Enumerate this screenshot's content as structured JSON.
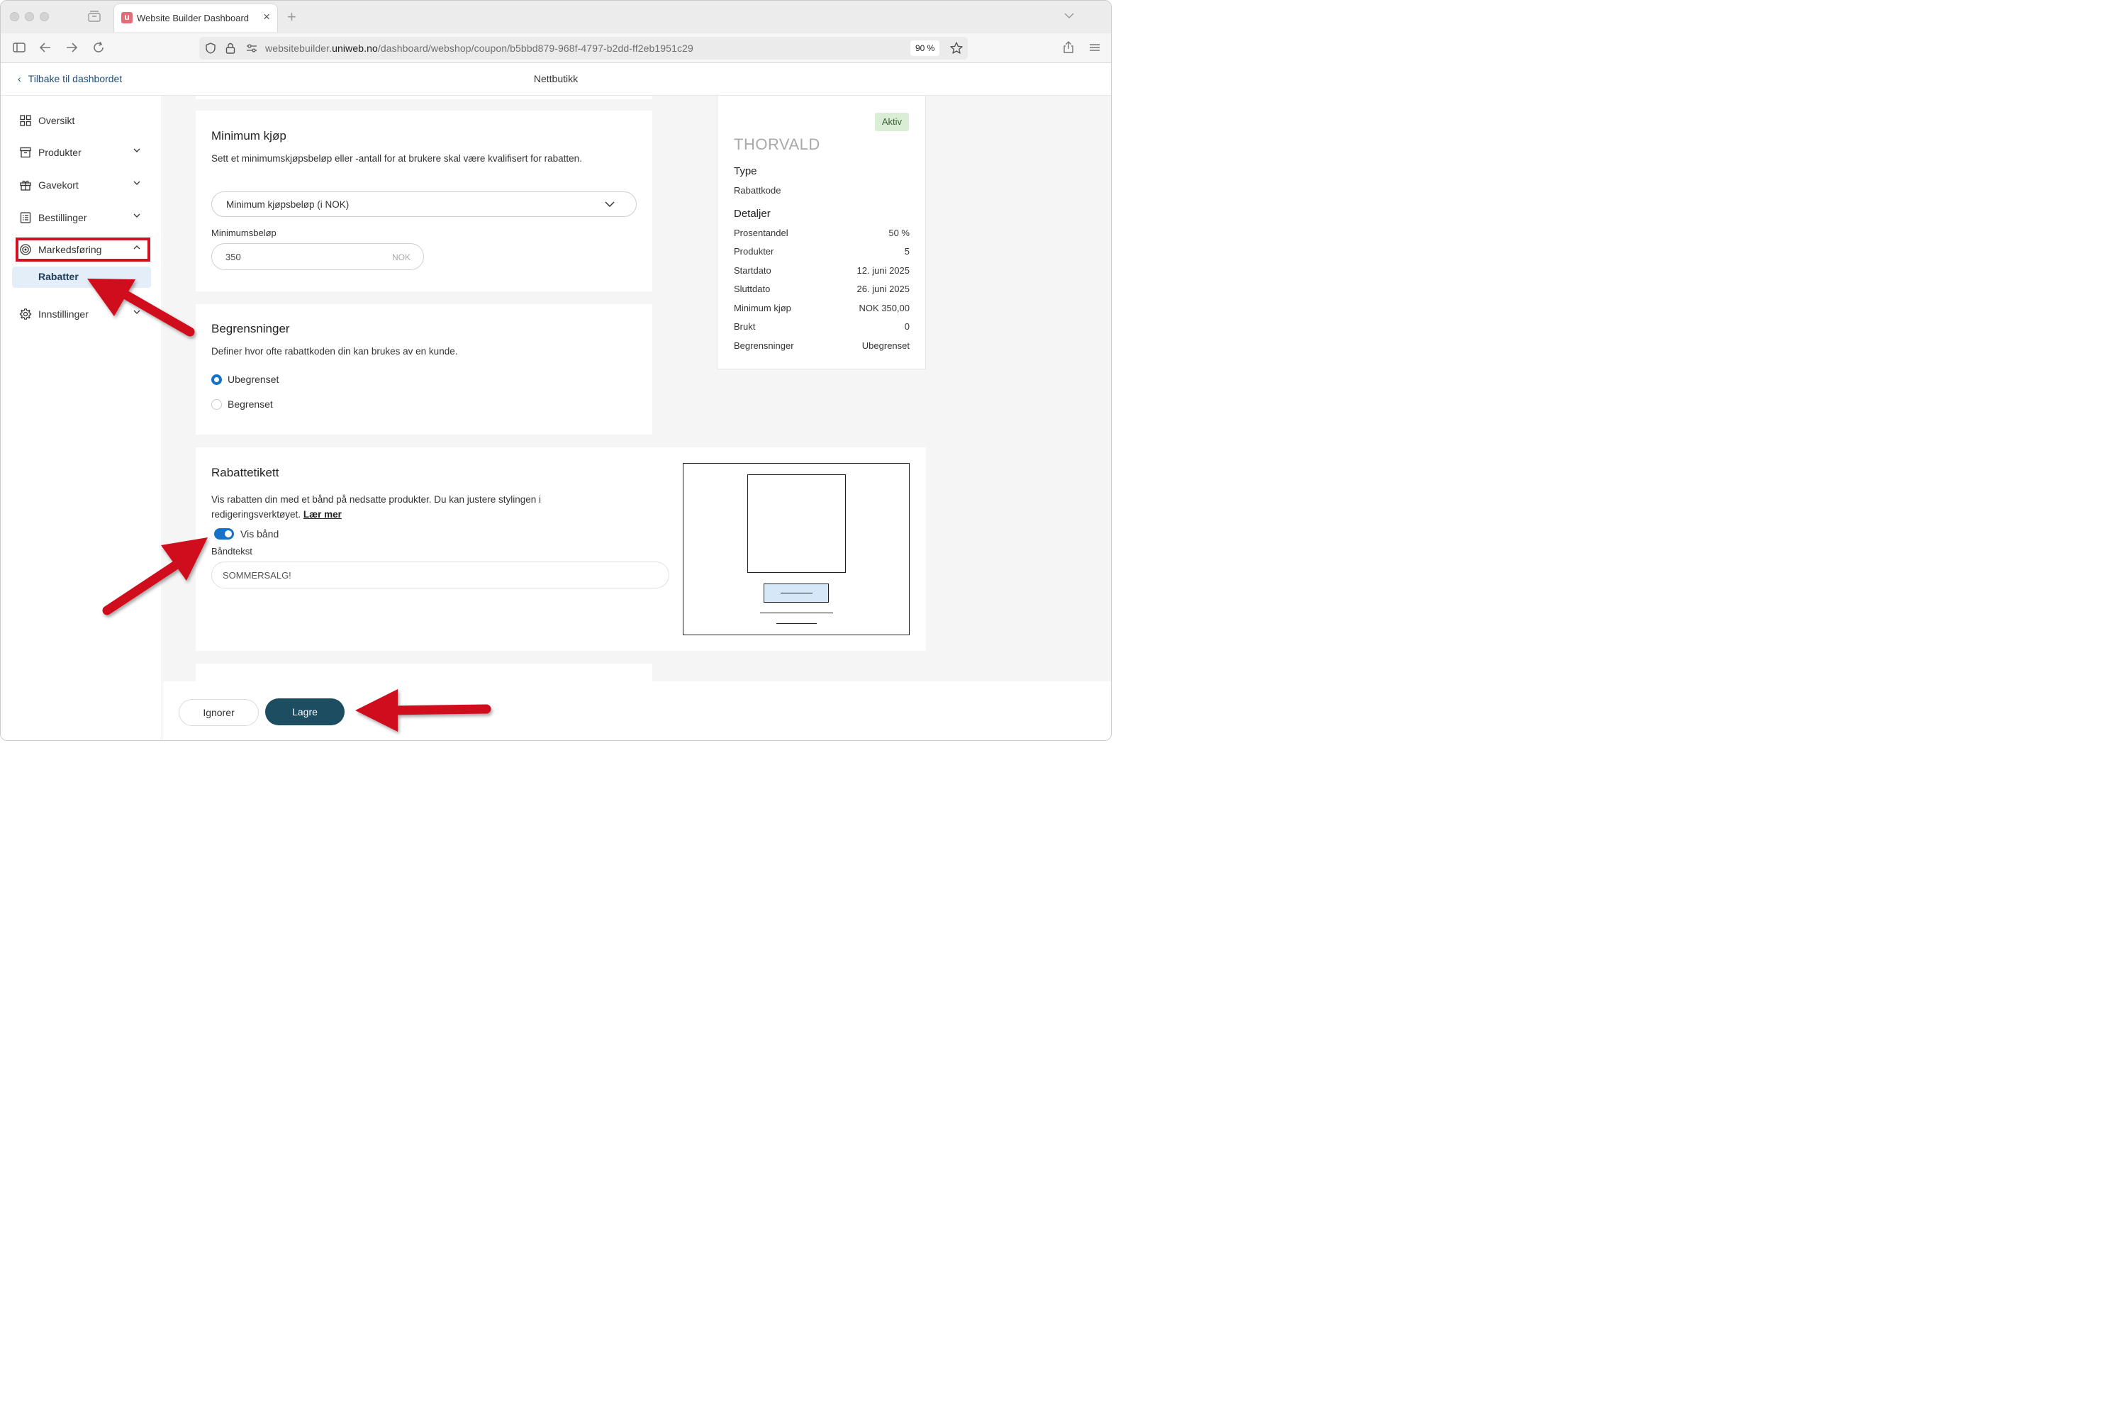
{
  "browser": {
    "tab_title": "Website Builder Dashboard",
    "favicon_letter": "u",
    "url_prefix": "websitebuilder.",
    "url_domain": "uniweb.no",
    "url_path": "/dashboard/webshop/coupon/b5bbd879-968f-4797-b2dd-ff2eb1951c29",
    "zoom": "90 %"
  },
  "header": {
    "back_label": "Tilbake til dashbordet",
    "title": "Nettbutikk"
  },
  "sidebar": {
    "items": [
      {
        "label": "Oversikt",
        "icon": "grid-icon"
      },
      {
        "label": "Produkter",
        "icon": "box-icon"
      },
      {
        "label": "Gavekort",
        "icon": "gift-icon"
      },
      {
        "label": "Bestillinger",
        "icon": "list-icon"
      },
      {
        "label": "Markedsføring",
        "icon": "target-icon"
      },
      {
        "label": "Innstillinger",
        "icon": "gear-icon"
      }
    ],
    "sub_item": "Rabatter"
  },
  "minimum_purchase": {
    "title": "Minimum kjøp",
    "description": "Sett et minimumskjøpsbeløp eller -antall for at brukere skal være kvalifisert for rabatten.",
    "select_value": "Minimum kjøpsbeløp (i NOK)",
    "amount_label": "Minimumsbeløp",
    "amount_value": "350",
    "amount_unit": "NOK"
  },
  "restrictions": {
    "title": "Begrensninger",
    "description": "Definer hvor ofte rabattkoden din kan brukes av en kunde.",
    "option_unlimited": "Ubegrenset",
    "option_limited": "Begrenset",
    "selected": "Ubegrenset"
  },
  "discount_label": {
    "title": "Rabattetikett",
    "description": "Vis rabatten din med et bånd på nedsatte produkter. Du kan justere stylingen i redigeringsverktøyet.",
    "learn_more": "Lær mer",
    "toggle_label": "Vis bånd",
    "toggle_on": true,
    "ribbon_text_label": "Båndtekst",
    "ribbon_text_value": "SOMMERSALG!"
  },
  "summary": {
    "status": "Aktiv",
    "code": "THORVALD",
    "type_heading": "Type",
    "type_value": "Rabattkode",
    "details_heading": "Detaljer",
    "rows": [
      {
        "key": "Prosentandel",
        "value": "50 %"
      },
      {
        "key": "Produkter",
        "value": "5"
      },
      {
        "key": "Startdato",
        "value": "12. juni 2025"
      },
      {
        "key": "Sluttdato",
        "value": "26. juni 2025"
      },
      {
        "key": "Minimum kjøp",
        "value": "NOK 350,00"
      },
      {
        "key": "Brukt",
        "value": "0"
      },
      {
        "key": "Begrensninger",
        "value": "Ubegrenset"
      }
    ]
  },
  "footer": {
    "ignore_label": "Ignorer",
    "save_label": "Lagre"
  },
  "colors": {
    "accent": "#1672c6",
    "save_button": "#1d4d61",
    "annotation_red": "#d0111f",
    "status_badge": "#d9eed4"
  }
}
